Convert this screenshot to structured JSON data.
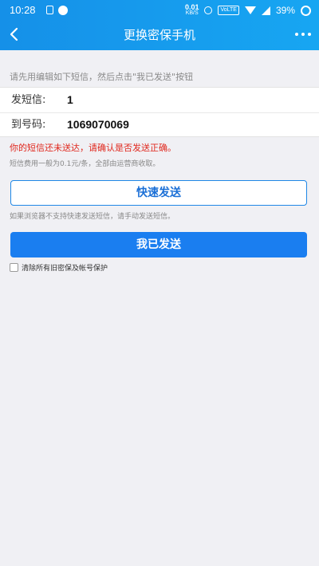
{
  "status_bar": {
    "time": "10:28",
    "net_speed_value": "0.01",
    "net_speed_unit": "KB/S",
    "volte": "VoLTE",
    "battery": "39%"
  },
  "header": {
    "title": "更换密保手机",
    "accent_color": "#1a8ee9"
  },
  "instruction": "请先用编辑如下短信，然后点击\"我已发送\"按钮",
  "sms": {
    "content_label": "发短信:",
    "content_value": "1",
    "number_label": "到号码:",
    "number_value": "1069070069"
  },
  "warning": "你的短信还未送达，请确认是否发送正确。",
  "fee_note": "短信费用一般为0.1元/条，全部由运营商收取。",
  "quick_send_label": "快速发送",
  "browser_hint": "如果浏览器不支持快速发送短信，请手动发送短信。",
  "confirm_label": "我已发送",
  "clear_checkbox": {
    "label": "清除所有旧密保及帐号保护",
    "checked": false
  },
  "colors": {
    "warning": "#e0271d",
    "primary_button": "#1a7ef0"
  }
}
